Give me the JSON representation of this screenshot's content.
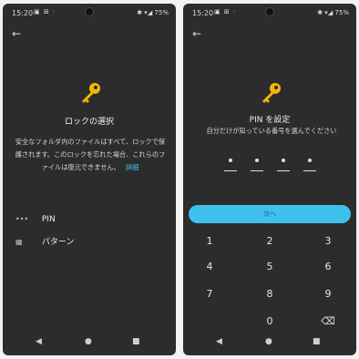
{
  "left_screen": {
    "status": {
      "time": "15:20",
      "icons": "▣ ⊞ ·",
      "right": "✱ ▾◢ 75%"
    },
    "back_icon": "←",
    "title": "ロックの選択",
    "description": "安全なフォルダ内のファイルはすべて、ロックで保護されます。このロックを忘れた場合、これらのファイルは復元できません。",
    "more_link": "詳細",
    "options": [
      {
        "label": "PIN",
        "icon_name": "pin-icon",
        "icon_glyph": "•••"
      },
      {
        "label": "パターン",
        "icon_name": "pattern-icon",
        "icon_glyph": "▦"
      }
    ],
    "navbar": {
      "back": "◀",
      "home": "●",
      "recent": "■"
    }
  },
  "right_screen": {
    "status": {
      "time": "15:20",
      "icons": "▣ ⊞ ·",
      "right": "✱ ▾◢ 75%"
    },
    "back_icon": "←",
    "title": "PIN を設定",
    "description": "自分だけが知っている番号を選んでください",
    "next_label": "次へ",
    "keys": [
      "1",
      "2",
      "3",
      "4",
      "5",
      "6",
      "7",
      "8",
      "9",
      "0"
    ],
    "backspace_glyph": "⌫",
    "navbar": {
      "back": "◀",
      "home": "●",
      "recent": "■"
    }
  },
  "colors": {
    "background": "#2b2c2b",
    "accent": "#3fc1ee",
    "key_icon": "#f2b705"
  },
  "icons": {
    "key": "key-icon"
  }
}
